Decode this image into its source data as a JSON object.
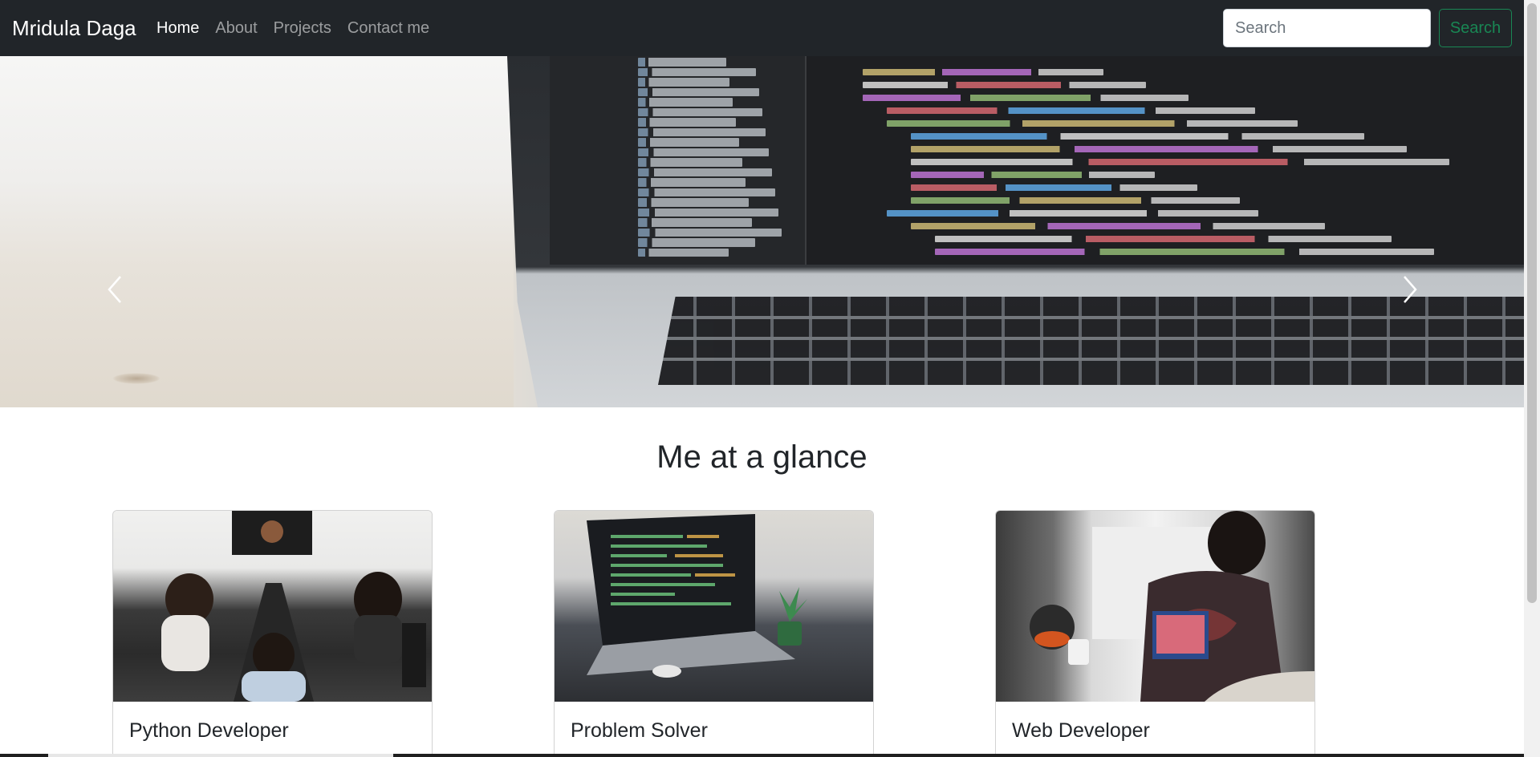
{
  "navbar": {
    "brand": "Mridula Daga",
    "links": [
      {
        "label": "Home",
        "active": true
      },
      {
        "label": "About",
        "active": false
      },
      {
        "label": "Projects",
        "active": false
      },
      {
        "label": "Contact me",
        "active": false
      }
    ],
    "search": {
      "placeholder": "Search",
      "value": ""
    },
    "search_button": "Search",
    "colors": {
      "background": "#212529",
      "accent": "#198754"
    }
  },
  "carousel": {
    "prev_icon": "chevron-left-icon",
    "next_icon": "chevron-right-icon"
  },
  "glance": {
    "title": "Me at a glance",
    "cards": [
      {
        "title": "Python Developer"
      },
      {
        "title": "Problem Solver"
      },
      {
        "title": "Web Developer"
      }
    ]
  }
}
